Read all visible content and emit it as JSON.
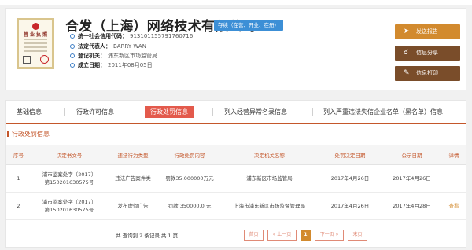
{
  "company": {
    "name": "合发（上海）网络技术有限公司",
    "status": "存续（在营、开业、在册）",
    "license_title": "营 业 执 照",
    "credit_code_label": "统一社会信用代码：",
    "credit_code": "913101155791760716",
    "legal_rep_label": "法定代表人：",
    "legal_rep": "BARRY WAN",
    "authority_label": "登记机关：",
    "authority": "浦东新区市场监管局",
    "established_label": "成立日期：",
    "established": "2011年08月05日"
  },
  "actions": {
    "send_report": "发送报告",
    "share": "信息分享",
    "print": "信息打印"
  },
  "tabs": [
    "基础信息",
    "行政许可信息",
    "行政处罚信息",
    "列入经营异常名录信息",
    "列入严重违法失信企业名单（黑名单）信息"
  ],
  "section_title": "行政处罚信息",
  "table": {
    "headers": [
      "序号",
      "决定书文号",
      "违法行为类型",
      "行政处罚内容",
      "决定机关名称",
      "处罚决定日期",
      "公示日期",
      "详情"
    ],
    "rows": [
      {
        "no": "1",
        "doc_line1": "浦市监案处字〔2017〕",
        "doc_line2": "第150201630575号",
        "type": "违法广告案件类",
        "content": "罚款35.000000万元",
        "authority": "浦东新区市场监管局",
        "decision_date": "2017年4月26日",
        "publish_date": "2017年4月26日",
        "detail": ""
      },
      {
        "no": "2",
        "doc_line1": "浦市监案处字〔2017〕",
        "doc_line2": "第150201630575号",
        "type": "发布虚假广告",
        "content": "罚款 350000.0 元",
        "authority": "上海市浦东新区市场监督管理局",
        "decision_date": "2017年4月26日",
        "publish_date": "2017年4月28日",
        "detail": "查看"
      }
    ]
  },
  "pager": {
    "summary": "共 查询到 2 条记录 共 1 页",
    "first": "首页",
    "prev": "« 上一页",
    "current": "1",
    "next": "下一页 »",
    "last": "末页"
  },
  "colors": {
    "accent": "#c4572b",
    "active_tab": "#e35a4c",
    "status_badge": "#3c8fd6",
    "button_dark": "#7a4d2a",
    "button_orange": "#d28a2e"
  }
}
